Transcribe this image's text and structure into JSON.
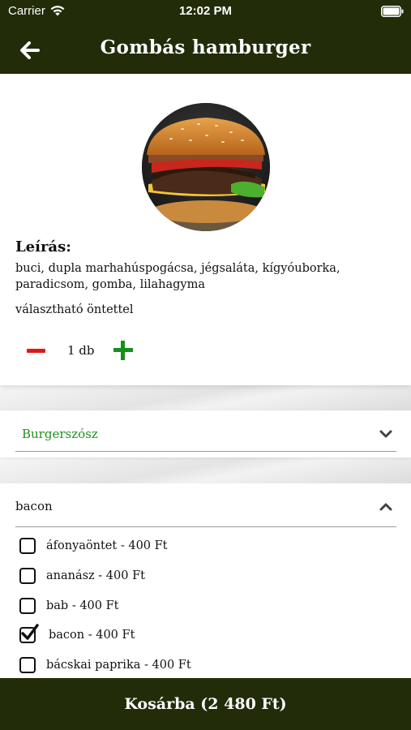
{
  "status_bar": {
    "carrier": "Carrier",
    "time": "12:02 PM"
  },
  "header": {
    "title": "Gombás hamburger",
    "back_icon": "arrow-left-icon"
  },
  "product": {
    "image": "burger-photo",
    "description_heading": "Leírás:",
    "description": "buci, dupla marhahúspogácsa, jégsaláta, kígyóuborka, paradicsom, gomba, lilahagyma",
    "option_note": "választható öntettel",
    "quantity": "1 db"
  },
  "sauce_section": {
    "label": "Burgerszósz",
    "expanded": false
  },
  "topping_section": {
    "label": "bacon",
    "expanded": true,
    "options": [
      {
        "label": "áfonyaöntet - 400 Ft",
        "checked": false
      },
      {
        "label": "ananász - 400 Ft",
        "checked": false
      },
      {
        "label": "bab - 400 Ft",
        "checked": false
      },
      {
        "label": "bacon - 400 Ft",
        "checked": true
      },
      {
        "label": "bácskai paprika - 400 Ft",
        "checked": false
      }
    ]
  },
  "cart": {
    "label": "Kosárba (2 480 Ft)"
  },
  "colors": {
    "header_bg": "#222c09",
    "accent_green": "#1f8f1f",
    "minus_red": "#e01818"
  }
}
